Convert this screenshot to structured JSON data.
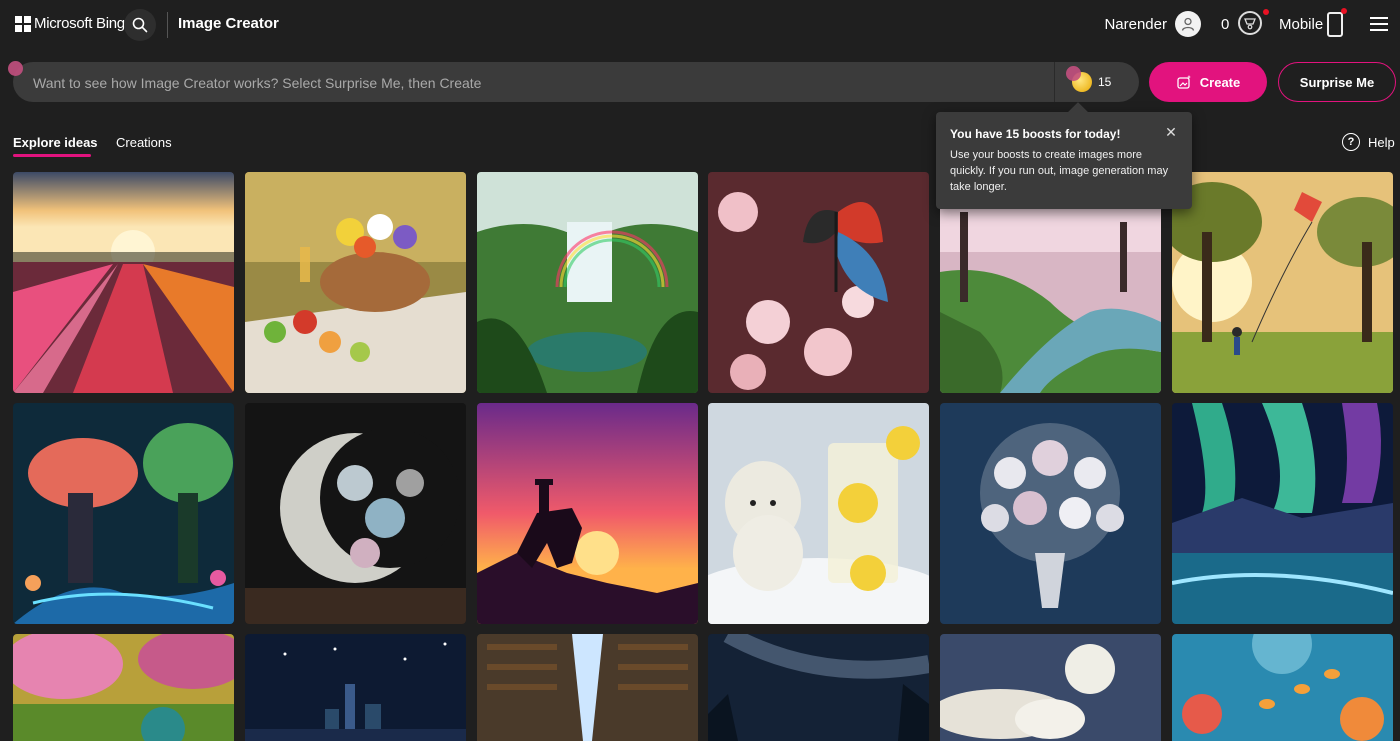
{
  "header": {
    "brand": "Microsoft Bing",
    "product": "Image Creator",
    "user_name": "Narender",
    "rewards_count": "0",
    "mobile_label": "Mobile"
  },
  "prompt": {
    "placeholder": "Want to see how Image Creator works? Select Surprise Me, then Create",
    "boosts": "15",
    "create_label": "Create",
    "surprise_label": "Surprise Me"
  },
  "tabs": {
    "explore": "Explore ideas",
    "creations": "Creations",
    "help": "Help"
  },
  "tooltip": {
    "title": "You have 15 boosts for today!",
    "body": "Use your boosts to create images more quickly. If you run out, image generation may take longer."
  },
  "colors": {
    "accent": "#e2137e",
    "background": "#1f1f1f",
    "input": "#3b3b3b"
  },
  "gallery": [
    "tulip-field-sunrise",
    "picnic-basket-flowers",
    "waterfall-rainbow",
    "butterfly-cherry-blossom",
    "cherry-blossom-canal",
    "kite-park",
    "neon-fantasy-forest",
    "crescent-moon-flowers",
    "cowboy-sunset-silhouette",
    "polar-bears-lemonade",
    "silver-flower-bouquet",
    "aurora-landscape",
    "peacock-garden",
    "city-night-sky",
    "endless-library",
    "milky-way-forest",
    "polar-bear-moon",
    "coral-reef-fish"
  ]
}
